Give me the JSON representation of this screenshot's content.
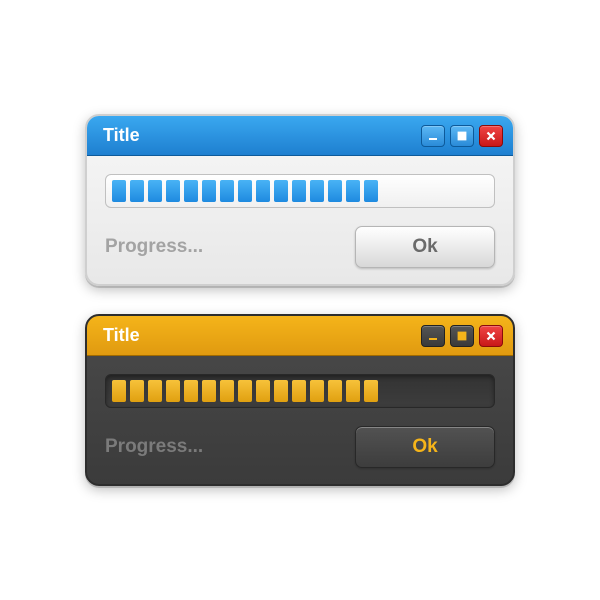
{
  "windows": [
    {
      "theme": "light",
      "title": "Title",
      "status": "Progress...",
      "ok_label": "Ok",
      "progress": {
        "filled": 15,
        "total": 22
      },
      "colors": {
        "accent": "#1e8ae0",
        "bg": "#eeeeee"
      }
    },
    {
      "theme": "dark",
      "title": "Title",
      "status": "Progress...",
      "ok_label": "Ok",
      "progress": {
        "filled": 15,
        "total": 22
      },
      "colors": {
        "accent": "#f5b41a",
        "bg": "#404040"
      }
    }
  ]
}
